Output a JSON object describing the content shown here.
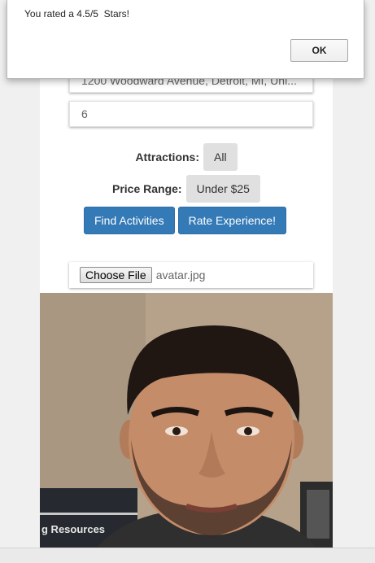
{
  "alert": {
    "message": "You rated a 4.5/5  Stars!",
    "ok_label": "OK"
  },
  "form": {
    "address_value": "1200 Woodward Avenue, Detroit, MI, Uni...",
    "count_value": "6",
    "attractions_label": "Attractions:",
    "attractions_value": "All",
    "price_label": "Price Range:",
    "price_value": "Under $25"
  },
  "actions": {
    "find_label": "Find Activities",
    "rate_label": "Rate Experience!"
  },
  "upload": {
    "button_label": "Choose File",
    "file_name": "avatar.jpg"
  },
  "photo": {
    "background_sign_text": "g Resources"
  },
  "colors": {
    "primary": "#337ab7",
    "pill": "#e0e0e0"
  }
}
